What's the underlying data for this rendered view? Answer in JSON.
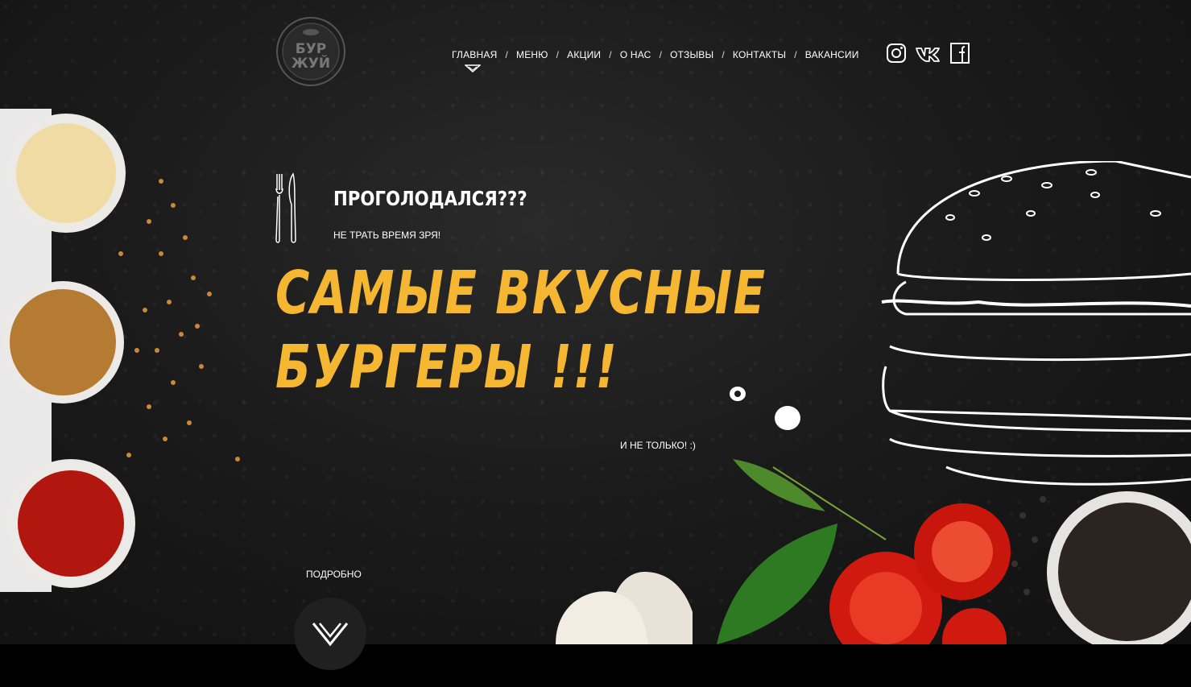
{
  "logo": {
    "line1": "БУР",
    "line2": "ЖУЙ"
  },
  "nav": {
    "items": [
      "ГЛАВНАЯ",
      "МЕНЮ",
      "АКЦИИ",
      "О НАС",
      "ОТЗЫВЫ",
      "КОНТАКТЫ",
      "ВАКАНСИИ"
    ],
    "separator": "/",
    "active": "ГЛАВНАЯ"
  },
  "social": [
    "instagram-icon",
    "vk-icon",
    "facebook-icon"
  ],
  "hero": {
    "tagline": "ПРОГОЛОДАЛСЯ???",
    "subtag": "НЕ ТРАТЬ ВРЕМЯ ЗРЯ!",
    "headline_line1": "САМЫЕ ВКУСНЫЕ",
    "headline_line2": "БУРГЕРЫ !!!",
    "note": "И НЕ ТОЛЬКО! :)",
    "more_label": "ПОДРОБНО"
  },
  "colors": {
    "accent": "#f5b731",
    "background": "#1b1b1b",
    "text": "#ffffff"
  }
}
